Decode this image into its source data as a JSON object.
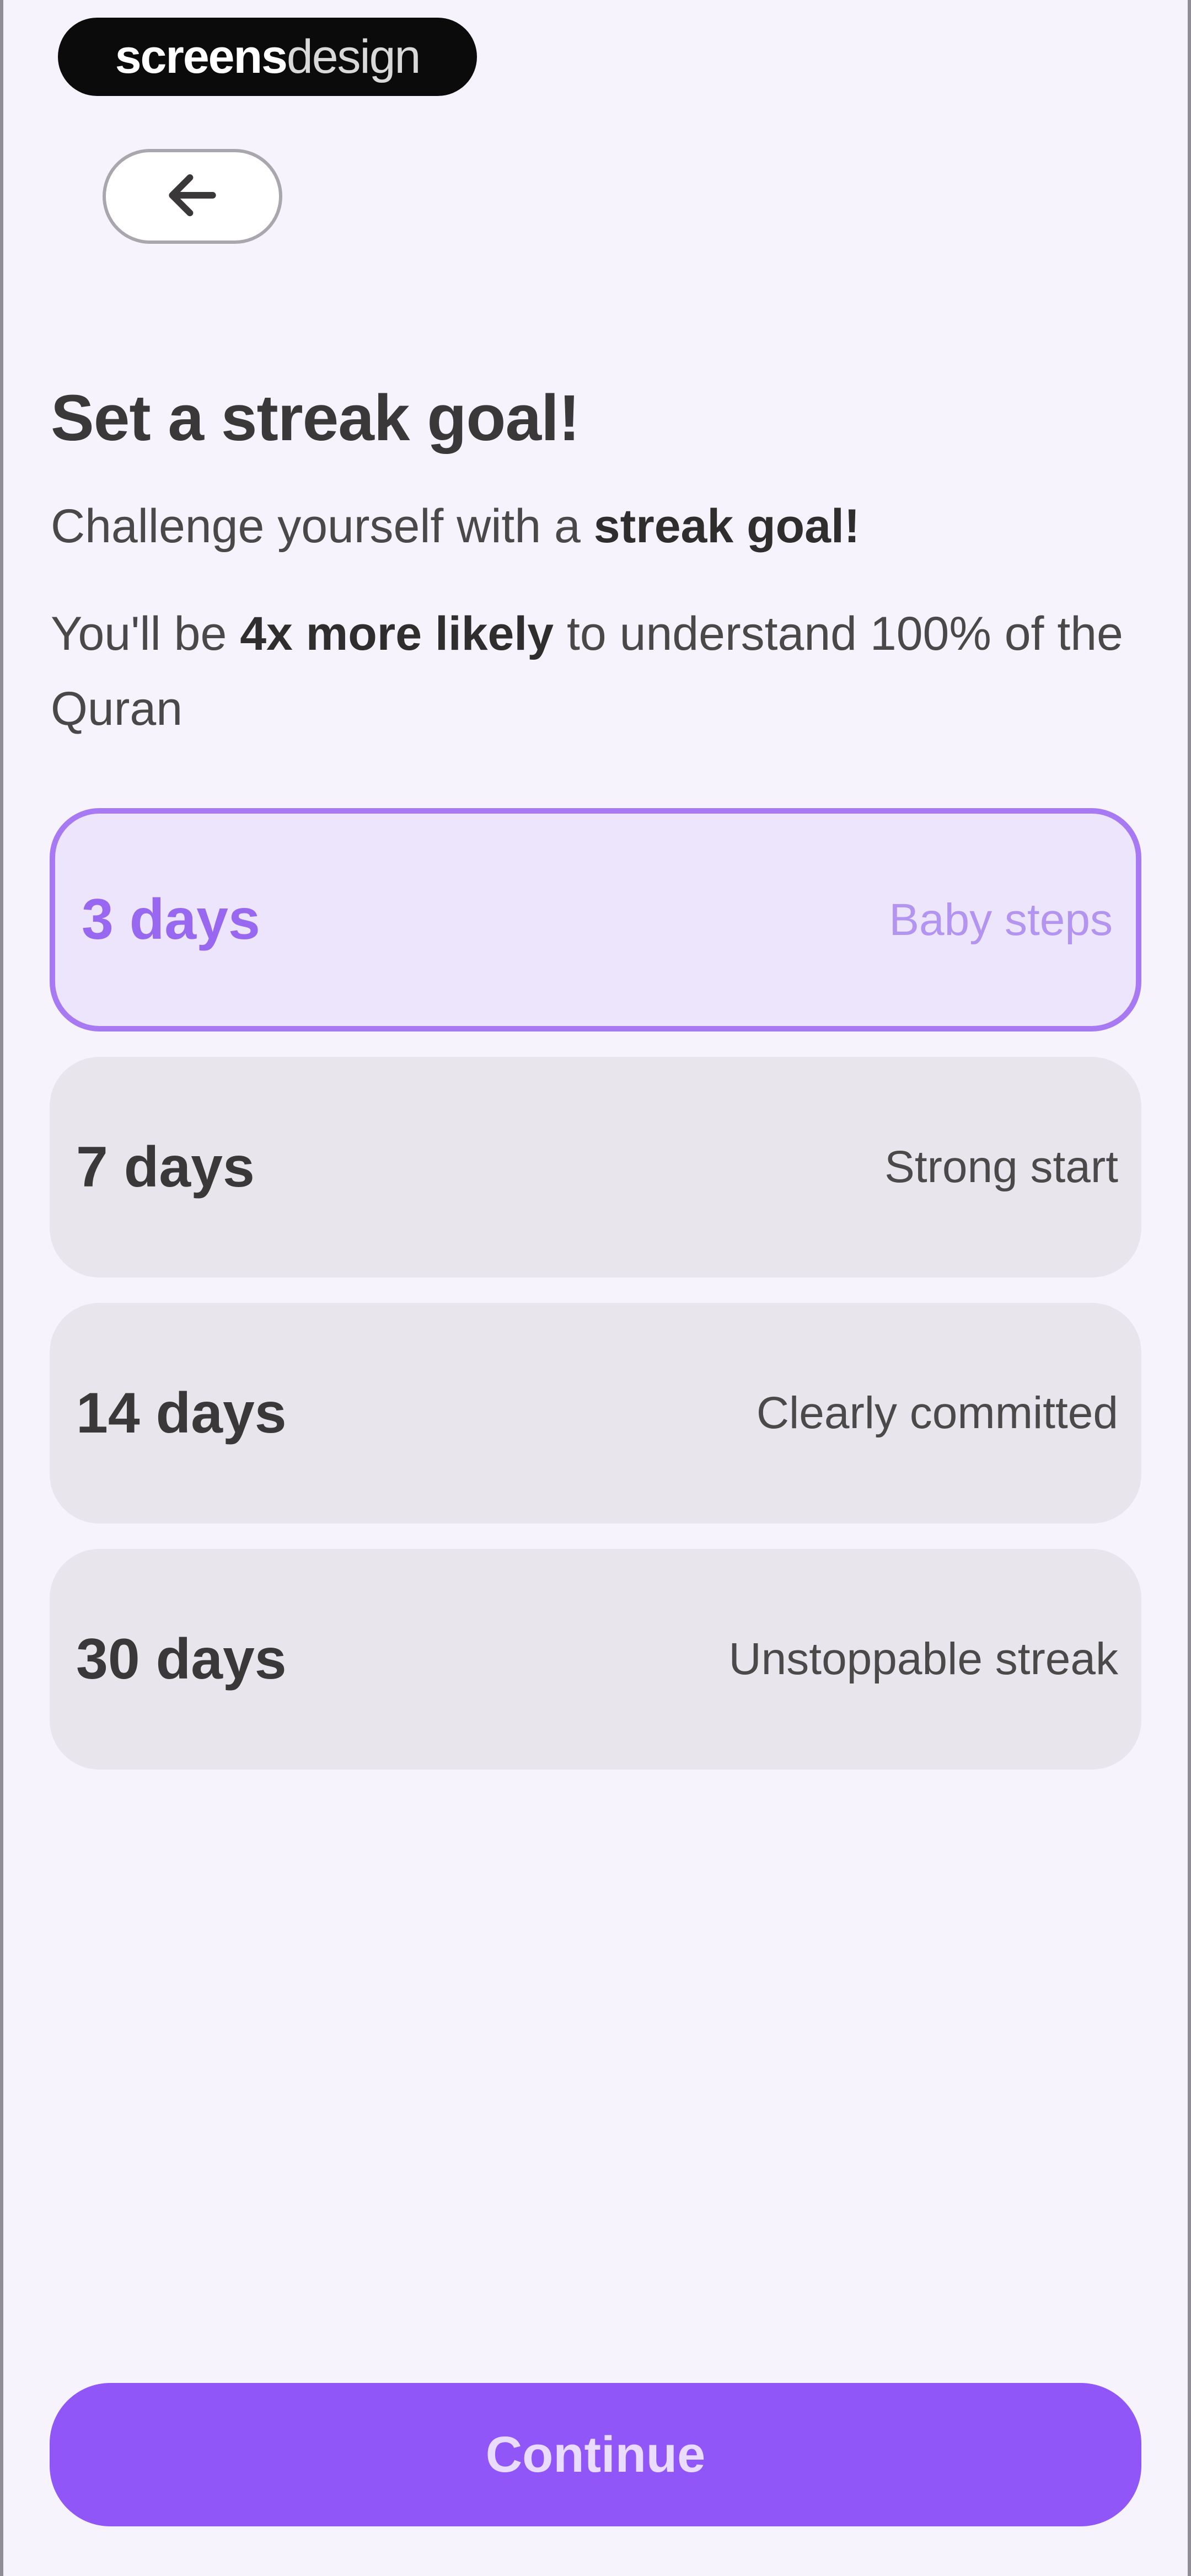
{
  "watermark": {
    "strong": "screens",
    "light": "design"
  },
  "header": {
    "back_icon": "arrow-left-icon"
  },
  "content": {
    "title": "Set a streak goal!",
    "subtitle_prefix": "Challenge yourself with a ",
    "subtitle_bold": "streak goal!",
    "likely_prefix": "You'll be ",
    "likely_bold": "4x more likely",
    "likely_suffix": " to understand 100% of the Quran"
  },
  "options": [
    {
      "days": "3 days",
      "label": "Baby steps",
      "selected": true
    },
    {
      "days": "7 days",
      "label": "Strong start",
      "selected": false
    },
    {
      "days": "14 days",
      "label": "Clearly committed",
      "selected": false
    },
    {
      "days": "30 days",
      "label": "Unstoppable streak",
      "selected": false
    }
  ],
  "footer": {
    "continue_label": "Continue"
  },
  "colors": {
    "accent": "#9156f8",
    "selected_border": "#a77af4",
    "selected_bg": "#ede5fb",
    "background": "#f6f3fd"
  }
}
